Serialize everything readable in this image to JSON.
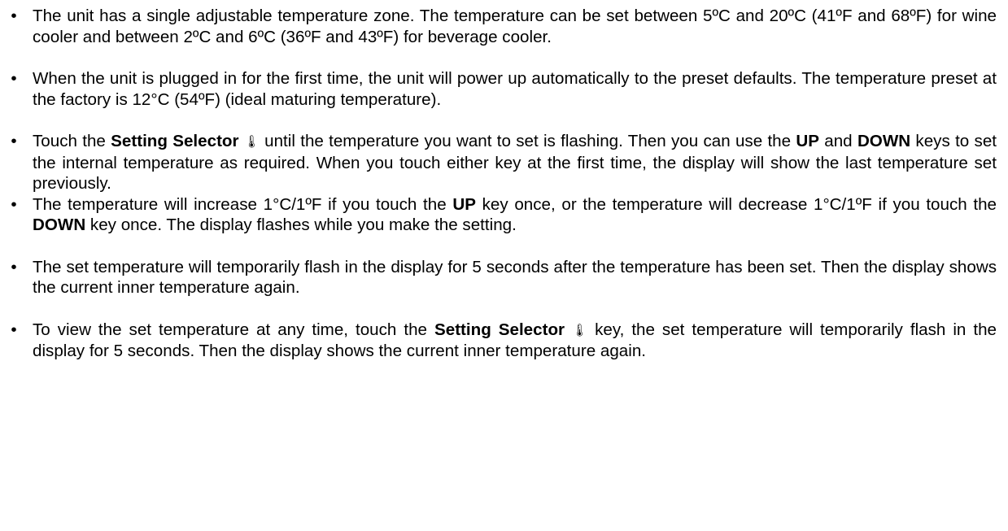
{
  "bullet_glyph": "•",
  "thermometer_glyph": "🌡",
  "item1": {
    "text": "The unit has a single adjustable temperature zone. The temperature can be set between 5ºC and 20ºC (41ºF and 68ºF) for wine cooler and between 2ºC and 6ºC (36ºF and 43ºF) for beverage cooler."
  },
  "item2": {
    "text": "When the unit is plugged in for the first time, the unit will power up automatically to the preset defaults. The temperature preset at the factory is 12°C (54ºF) (ideal maturing temperature)."
  },
  "item3": {
    "t1": "Touch the ",
    "b1": "Setting Selector",
    "t2": " until the temperature you want to set is flashing. Then you can use the ",
    "b2": "UP",
    "t3": " and ",
    "b3": "DOWN",
    "t4": " keys to set the internal temperature as required. When you touch either key at the first time, the display will show the last temperature set previously."
  },
  "item4": {
    "t1": "The temperature will increase 1°C/1ºF if you touch the ",
    "b1": "UP",
    "t2": " key once, or the temperature will decrease 1°C/1ºF if you touch the ",
    "b2": "DOWN",
    "t3": " key once. The display flashes while you make the setting."
  },
  "item5": {
    "text": "The set temperature will temporarily flash in the display for 5 seconds after the temperature has been set. Then the display shows the current inner temperature again."
  },
  "item6": {
    "t1": "To view the set temperature at any time, touch the ",
    "b1": "Setting Selector",
    "t2": " key, the set temperature will temporarily flash in the display for 5 seconds. Then the display shows the current inner temperature again."
  }
}
